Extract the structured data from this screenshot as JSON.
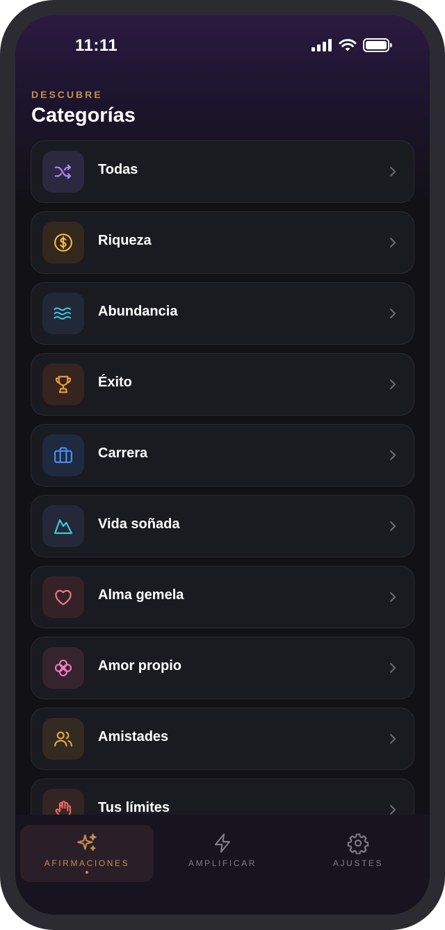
{
  "status_bar": {
    "time": "11:11"
  },
  "header": {
    "eyebrow": "DESCUBRE",
    "title": "Categorías"
  },
  "categories": [
    {
      "label": "Todas",
      "icon": "shuffle-icon",
      "color": "#a78bfa",
      "bg": "#2c2840"
    },
    {
      "label": "Riqueza",
      "icon": "dollar-coin-icon",
      "color": "#f5b942",
      "bg": "#33281e"
    },
    {
      "label": "Abundancia",
      "icon": "waves-icon",
      "color": "#3cc6d8",
      "bg": "#222838"
    },
    {
      "label": "Éxito",
      "icon": "trophy-icon",
      "color": "#f0a030",
      "bg": "#352420"
    },
    {
      "label": "Carrera",
      "icon": "briefcase-icon",
      "color": "#4a90f0",
      "bg": "#1e2a40"
    },
    {
      "label": "Vida soñada",
      "icon": "mountain-icon",
      "color": "#3cd0d8",
      "bg": "#242838"
    },
    {
      "label": "Alma gemela",
      "icon": "heart-icon",
      "color": "#f27a8a",
      "bg": "#352229"
    },
    {
      "label": "Amor propio",
      "icon": "flower-icon",
      "color": "#f07ab8",
      "bg": "#35232e"
    },
    {
      "label": "Amistades",
      "icon": "users-icon",
      "color": "#e8a848",
      "bg": "#332a22"
    },
    {
      "label": "Tus límites",
      "icon": "hand-icon",
      "color": "#f06a60",
      "bg": "#352424"
    }
  ],
  "tabs": [
    {
      "label": "AFIRMACIONES",
      "icon": "sparkles-icon",
      "active": true
    },
    {
      "label": "AMPLIFICAR",
      "icon": "lightning-icon",
      "active": false
    },
    {
      "label": "AJUSTES",
      "icon": "gear-icon",
      "active": false
    }
  ],
  "colors": {
    "accent": "#c98c4e",
    "background": "#111116",
    "card": "#1a1b21"
  }
}
